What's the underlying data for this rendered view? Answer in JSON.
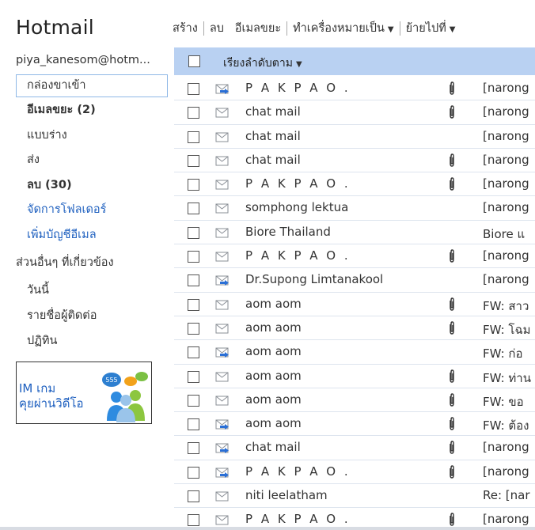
{
  "brand": "Hotmail",
  "account": "piya_kanesom@hotm...",
  "folders": [
    {
      "label": "กล่องขาเข้า",
      "state": "selected"
    },
    {
      "label": "อีเมลขยะ (2)",
      "state": "bold"
    },
    {
      "label": "แบบร่าง",
      "state": "normal"
    },
    {
      "label": "ส่ง",
      "state": "normal"
    },
    {
      "label": "ลบ (30)",
      "state": "bold"
    },
    {
      "label": "จัดการโฟลเดอร์",
      "state": "link"
    },
    {
      "label": "เพิ่มบัญชีอีเมล",
      "state": "link"
    }
  ],
  "section_title": "ส่วนอื่นๆ ที่เกี่ยวข้อง",
  "sub_items": [
    "วันนี้",
    "รายชื่อผู้ติดต่อ",
    "ปฏิทิน"
  ],
  "ad": {
    "line1": "IM เกม",
    "line2": "คุยผ่านวิดีโอ",
    "bubble_text": "555"
  },
  "toolbar": {
    "new": "สร้าง",
    "delete": "ลบ",
    "junk": "อีเมลขยะ",
    "mark_as": "ทำเครื่องหมายเป็น",
    "move_to": "ย้ายไปที่"
  },
  "list_header": {
    "sort": "เรียงลำดับตาม"
  },
  "colors": {
    "header_bg": "#b9d1f2",
    "selected_border": "#8fb8e6",
    "link": "#1d5fbf",
    "reply_arrow": "#2a6fd6"
  },
  "messages": [
    {
      "sender": "P A K P A O .",
      "spaced": true,
      "replied": true,
      "attachment": true,
      "subject": "[narong"
    },
    {
      "sender": "chat mail",
      "spaced": false,
      "replied": false,
      "attachment": true,
      "subject": "[narong"
    },
    {
      "sender": "chat mail",
      "spaced": false,
      "replied": false,
      "attachment": false,
      "subject": "[narong"
    },
    {
      "sender": "chat mail",
      "spaced": false,
      "replied": false,
      "attachment": true,
      "subject": "[narong"
    },
    {
      "sender": "P A K P A O .",
      "spaced": true,
      "replied": false,
      "attachment": true,
      "subject": "[narong"
    },
    {
      "sender": "somphong lektua",
      "spaced": false,
      "replied": false,
      "attachment": false,
      "subject": "[narong"
    },
    {
      "sender": "Biore Thailand",
      "spaced": false,
      "replied": false,
      "attachment": false,
      "subject": "Biore แ"
    },
    {
      "sender": "P A K P A O .",
      "spaced": true,
      "replied": false,
      "attachment": true,
      "subject": "[narong"
    },
    {
      "sender": "Dr.Supong Limtanakool",
      "spaced": false,
      "replied": true,
      "attachment": false,
      "subject": "[narong"
    },
    {
      "sender": "aom aom",
      "spaced": false,
      "replied": false,
      "attachment": true,
      "subject": "FW: สาว"
    },
    {
      "sender": "aom aom",
      "spaced": false,
      "replied": false,
      "attachment": true,
      "subject": "FW: โฉม"
    },
    {
      "sender": "aom aom",
      "spaced": false,
      "replied": true,
      "attachment": false,
      "subject": "FW: ก่อ"
    },
    {
      "sender": "aom aom",
      "spaced": false,
      "replied": false,
      "attachment": true,
      "subject": "FW: ท่าน"
    },
    {
      "sender": "aom aom",
      "spaced": false,
      "replied": false,
      "attachment": true,
      "subject": "FW: ขอ"
    },
    {
      "sender": "aom aom",
      "spaced": false,
      "replied": true,
      "attachment": true,
      "subject": "FW: ต้อง"
    },
    {
      "sender": "chat mail",
      "spaced": false,
      "replied": true,
      "attachment": true,
      "subject": "[narong"
    },
    {
      "sender": "P A K P A O .",
      "spaced": true,
      "replied": true,
      "attachment": true,
      "subject": "[narong"
    },
    {
      "sender": "niti leelatham",
      "spaced": false,
      "replied": false,
      "attachment": false,
      "subject": "Re: [nar"
    },
    {
      "sender": "P A K P A O .",
      "spaced": true,
      "replied": false,
      "attachment": true,
      "subject": "[narong"
    }
  ]
}
